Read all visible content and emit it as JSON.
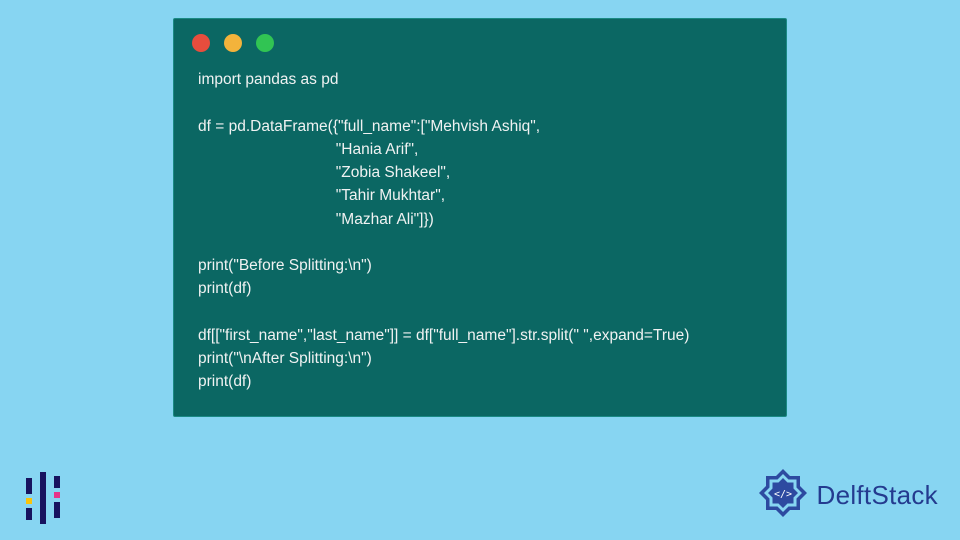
{
  "window": {
    "dots": {
      "red": "#e74d3d",
      "yellow": "#f3b33b",
      "green": "#31c453"
    },
    "background": "#0b6763"
  },
  "code": {
    "lines": [
      "import pandas as pd",
      "",
      "df = pd.DataFrame({\"full_name\":[\"Mehvish Ashiq\",",
      "                                \"Hania Arif\",",
      "                                \"Zobia Shakeel\",",
      "                                \"Tahir Mukhtar\",",
      "                                \"Mazhar Ali\"]})",
      "",
      "print(\"Before Splitting:\\n\")",
      "print(df)",
      "",
      "df[[\"first_name\",\"last_name\"]] = df[\"full_name\"].str.split(\" \",expand=True)",
      "print(\"\\nAfter Splitting:\\n\")",
      "print(df)"
    ]
  },
  "brand": {
    "name": "DelftStack"
  }
}
